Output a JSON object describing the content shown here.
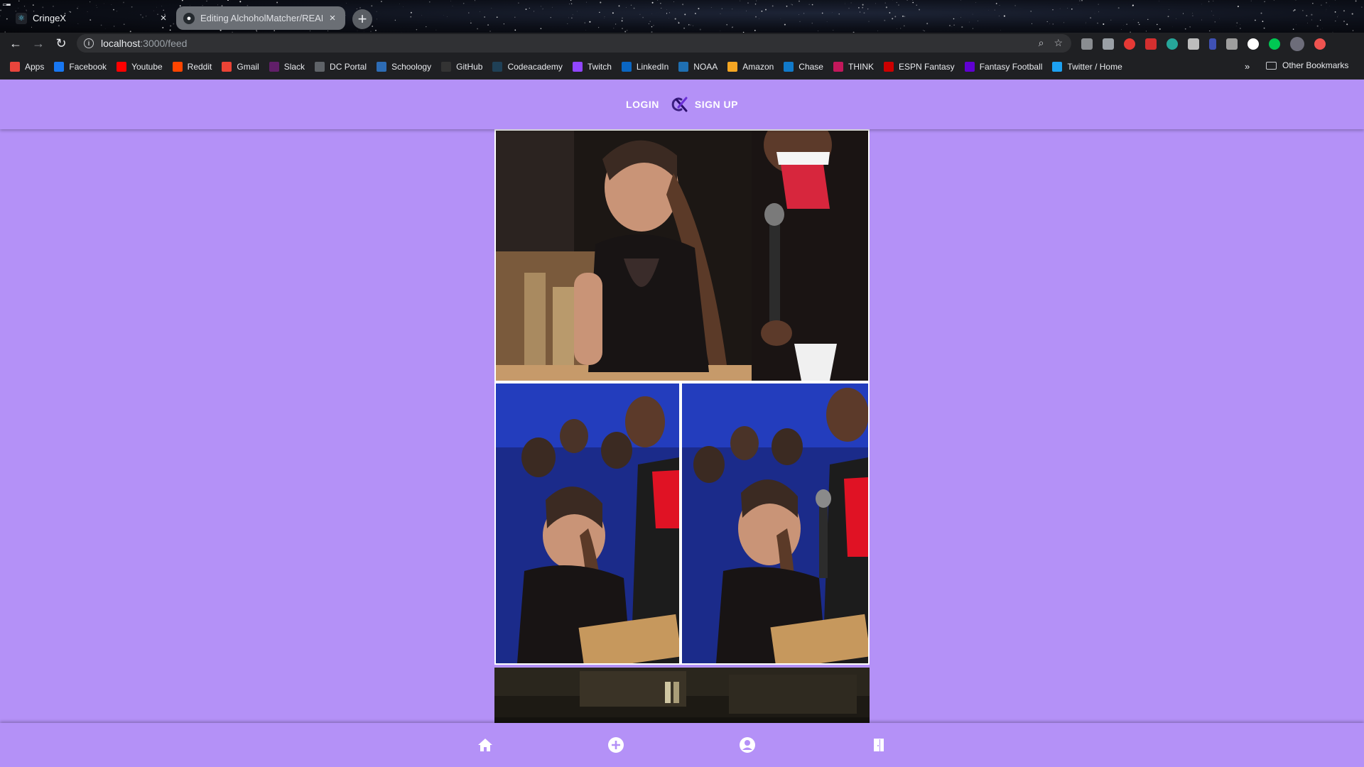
{
  "browser": {
    "tabs": [
      {
        "title": "CringeX",
        "active": true,
        "icon": "react-icon"
      },
      {
        "title": "Editing AlchoholMatcher/READ",
        "active": false,
        "icon": "github-icon"
      }
    ],
    "url_host": "localhost",
    "url_path": ":3000/feed",
    "bookmarks": [
      {
        "label": "Apps",
        "icon": "apps-grid-icon",
        "color": "#e8453c"
      },
      {
        "label": "Facebook",
        "icon": "facebook-icon",
        "color": "#1877f2"
      },
      {
        "label": "Youtube",
        "icon": "youtube-icon",
        "color": "#ff0000"
      },
      {
        "label": "Reddit",
        "icon": "reddit-icon",
        "color": "#ff4500"
      },
      {
        "label": "Gmail",
        "icon": "gmail-icon",
        "color": "#ea4335"
      },
      {
        "label": "Slack",
        "icon": "slack-icon",
        "color": "#611f69"
      },
      {
        "label": "DC Portal",
        "icon": "globe-icon",
        "color": "#5f6368"
      },
      {
        "label": "Schoology",
        "icon": "schoology-icon",
        "color": "#2d6cb5"
      },
      {
        "label": "GitHub",
        "icon": "github-icon",
        "color": "#333333"
      },
      {
        "label": "Codeacademy",
        "icon": "codecademy-icon",
        "color": "#1f4056"
      },
      {
        "label": "Twitch",
        "icon": "twitch-icon",
        "color": "#9146ff"
      },
      {
        "label": "LinkedIn",
        "icon": "linkedin-icon",
        "color": "#0a66c2"
      },
      {
        "label": "NOAA",
        "icon": "noaa-icon",
        "color": "#1f6fb2"
      },
      {
        "label": "Amazon",
        "icon": "amazon-icon",
        "color": "#f5a623"
      },
      {
        "label": "Chase",
        "icon": "chase-icon",
        "color": "#117aca"
      },
      {
        "label": "THINK",
        "icon": "think-icon",
        "color": "#c2185b"
      },
      {
        "label": "ESPN Fantasy",
        "icon": "espn-icon",
        "color": "#cc0000"
      },
      {
        "label": "Fantasy Football",
        "icon": "yahoo-icon",
        "color": "#6001d2"
      },
      {
        "label": "Twitter / Home",
        "icon": "twitter-icon",
        "color": "#1da1f2"
      }
    ],
    "more_bookmarks": "»",
    "other_bookmarks": "Other Bookmarks"
  },
  "app": {
    "header": {
      "login": "LOGIN",
      "signup": "SIGN UP",
      "logo_letter": "CX",
      "accent": "#b491f7"
    },
    "posts": [
      {
        "id": "post-1",
        "layout": "collage",
        "description": "event photo collage"
      },
      {
        "id": "post-2",
        "layout": "single",
        "description": "night street photo"
      }
    ],
    "bottom_nav": [
      {
        "name": "home",
        "icon": "home-icon"
      },
      {
        "name": "add-post",
        "icon": "plus-circle-icon"
      },
      {
        "name": "profile",
        "icon": "account-circle-icon"
      },
      {
        "name": "logout",
        "icon": "door-exit-icon"
      }
    ]
  }
}
